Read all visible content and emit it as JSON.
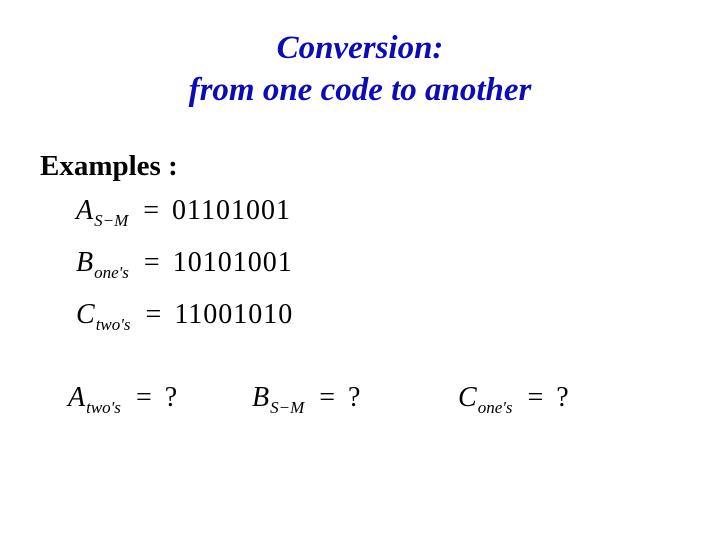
{
  "title": {
    "line1": "Conversion:",
    "line2": "from one code to another"
  },
  "examples_label": "Examples :",
  "equations": [
    {
      "var": "A",
      "sub": "S−M",
      "value": "01101001"
    },
    {
      "var": "B",
      "sub": "one's",
      "value": "10101001"
    },
    {
      "var": "C",
      "sub": "two's",
      "value": "11001010"
    }
  ],
  "questions": [
    {
      "var": "A",
      "sub": "two's",
      "rhs": "?"
    },
    {
      "var": "B",
      "sub": "S−M",
      "rhs": "?"
    },
    {
      "var": "C",
      "sub": "one's",
      "rhs": "?"
    }
  ],
  "chart_data": {
    "type": "table",
    "title": "Binary code representations and conversion queries",
    "rows": [
      {
        "variable": "A",
        "encoding": "S−M",
        "binary": "01101001"
      },
      {
        "variable": "B",
        "encoding": "one's",
        "binary": "10101001"
      },
      {
        "variable": "C",
        "encoding": "two's",
        "binary": "11001010"
      }
    ],
    "unknowns": [
      {
        "variable": "A",
        "encoding": "two's"
      },
      {
        "variable": "B",
        "encoding": "S−M"
      },
      {
        "variable": "C",
        "encoding": "one's"
      }
    ]
  }
}
